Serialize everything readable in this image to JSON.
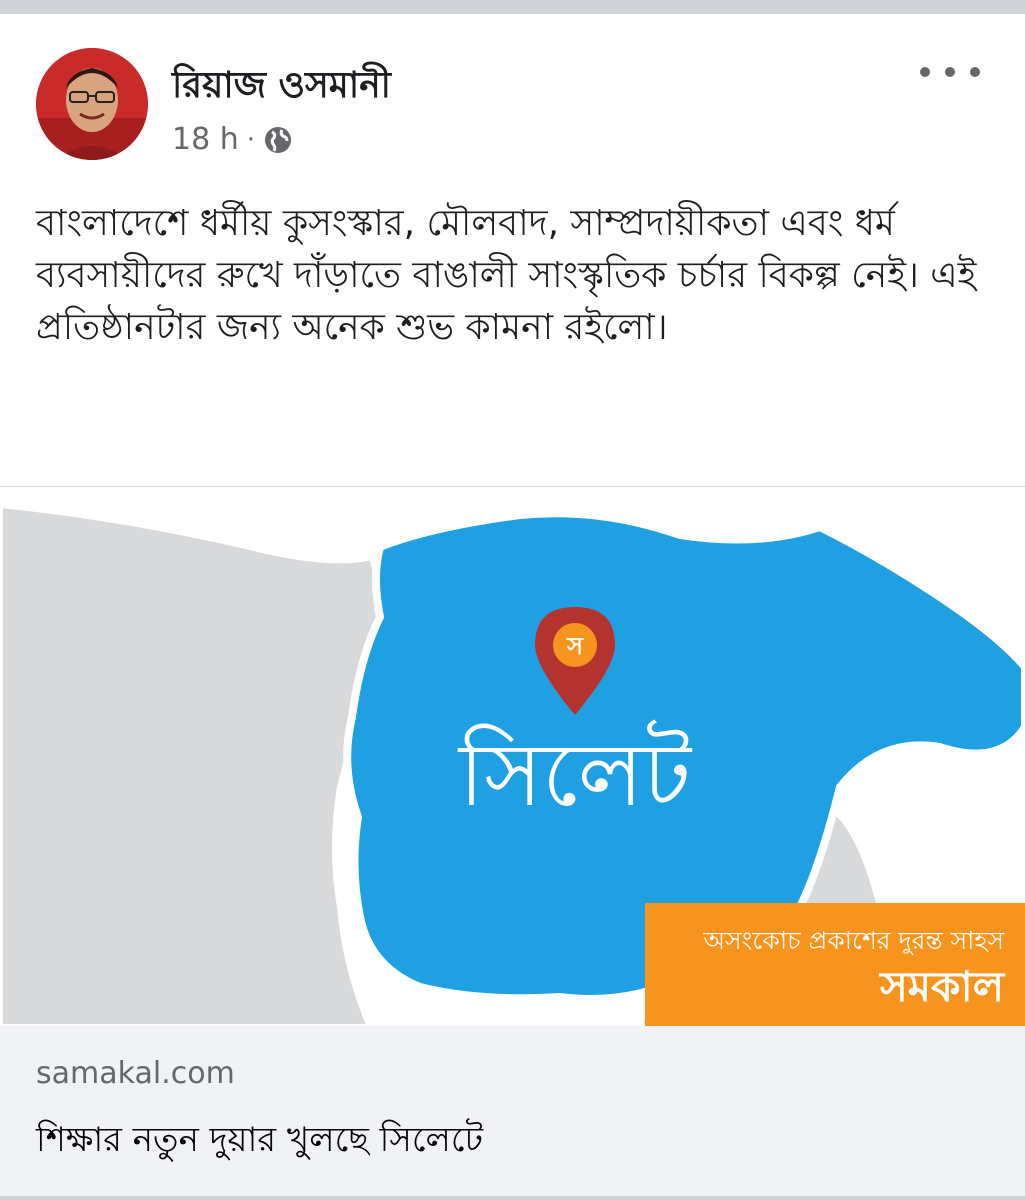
{
  "post": {
    "author_name": "রিয়াজ ওসমানী",
    "timestamp": "18 h",
    "separator": "·",
    "privacy_icon": "globe-icon",
    "more_icon": "more-horizontal-icon",
    "text": "বাংলাদেশে ধর্মীয় কুসংস্কার, মৌলবাদ, সাম্প্রদায়ীকতা এবং ধর্ম ব্যবসায়ীদের রুখে দাঁড়াতে বাঙালী সাংস্কৃতিক চর্চার বিকল্প নেই। এই প্রতিষ্ঠানটার জন্য অনেক শুভ কামনা রইলো।"
  },
  "link_preview": {
    "map_label": "সিলেট",
    "pin_letter": "স",
    "banner_tagline": "অসংকোচ প্রকাশের দুরন্ত সাহস",
    "banner_brand": "সমকাল",
    "domain": "samakal.com",
    "title": "শিক্ষার নতুন দুয়ার খুলছে সিলেটে"
  },
  "colors": {
    "region_blue": "#1ea0e3",
    "region_gray": "#d8d9db",
    "banner_orange": "#f7941d",
    "pin_red": "#b5332e",
    "meta_gray": "#65676b",
    "card_bg": "#f0f2f5"
  }
}
